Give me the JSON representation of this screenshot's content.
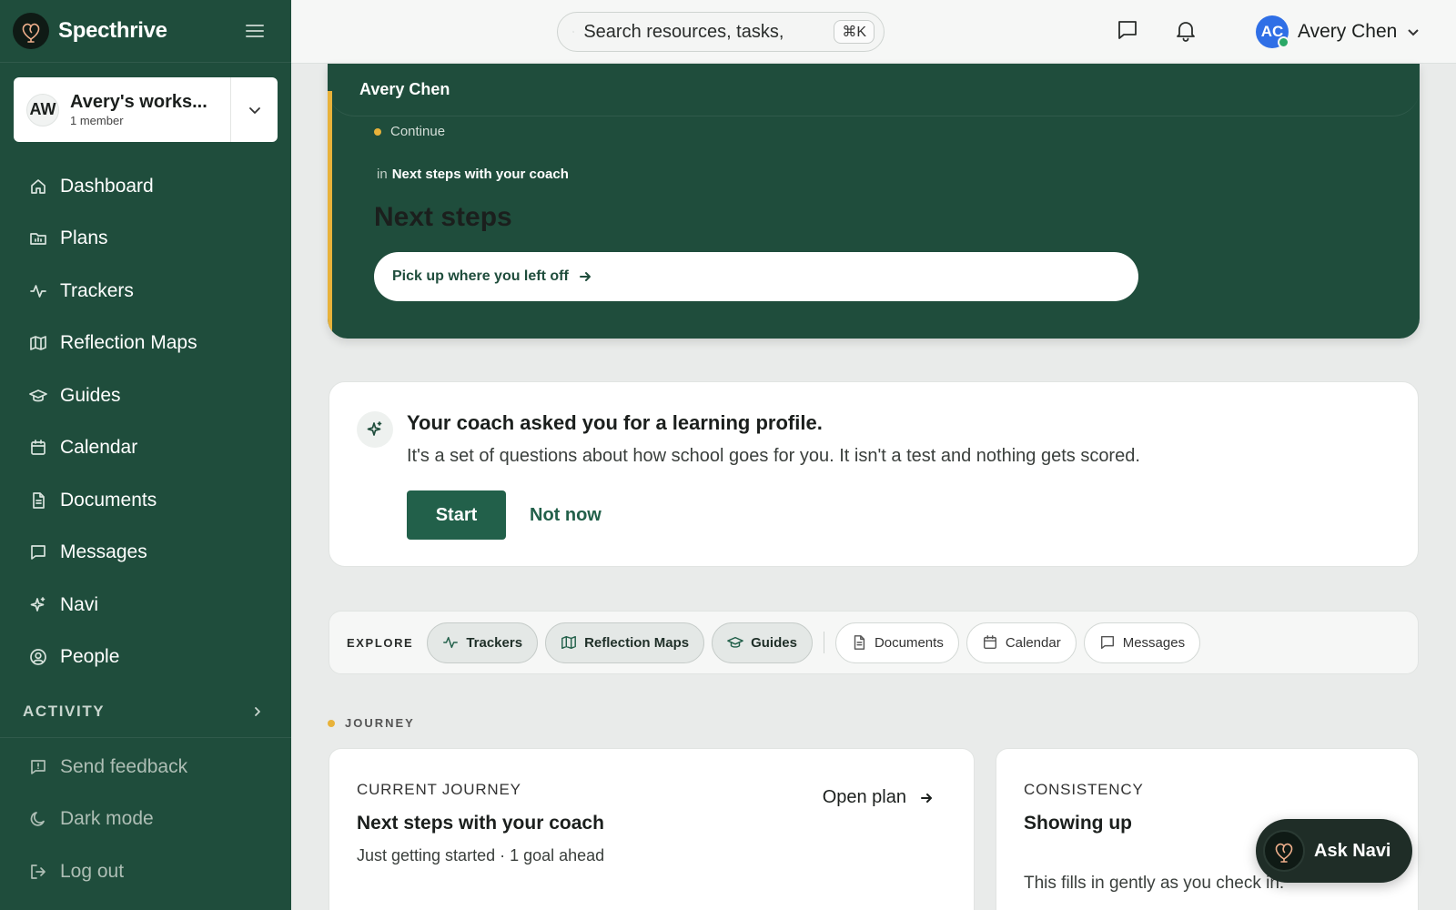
{
  "brand": {
    "name": "Specthrive"
  },
  "workspace": {
    "initials": "AW",
    "name": "Avery's works...",
    "members": "1 member"
  },
  "nav": {
    "items": [
      {
        "label": "Dashboard"
      },
      {
        "label": "Plans"
      },
      {
        "label": "Trackers"
      },
      {
        "label": "Reflection Maps"
      },
      {
        "label": "Guides"
      },
      {
        "label": "Calendar"
      },
      {
        "label": "Documents"
      },
      {
        "label": "Messages"
      },
      {
        "label": "Navi"
      },
      {
        "label": "People"
      }
    ],
    "section": "ACTIVITY",
    "footer": [
      {
        "label": "Send feedback"
      },
      {
        "label": "Dark mode"
      },
      {
        "label": "Log out"
      }
    ]
  },
  "topbar": {
    "search_placeholder": "Search resources, tasks,",
    "shortcut": "⌘K",
    "user_initials": "AC",
    "user_name": "Avery Chen"
  },
  "hero": {
    "owner": "Avery Chen",
    "status": "Continue",
    "context_prefix": "in",
    "context": "Next steps with your coach",
    "title": "Next steps",
    "cta": "Pick up where you left off"
  },
  "prompt": {
    "title": "Your coach asked you for a learning profile.",
    "body": "It's a set of questions about how school goes for you. It isn't a test and nothing gets scored.",
    "start": "Start",
    "later": "Not now"
  },
  "explore": {
    "label": "EXPLORE",
    "primary": [
      "Trackers",
      "Reflection Maps",
      "Guides"
    ],
    "secondary": [
      "Documents",
      "Calendar",
      "Messages"
    ]
  },
  "journey": {
    "section": "JOURNEY",
    "current": {
      "eyebrow": "CURRENT JOURNEY",
      "title": "Next steps with your coach",
      "sub": "Just getting started · 1 goal ahead",
      "link": "Open plan"
    },
    "consistency": {
      "eyebrow": "CONSISTENCY",
      "title": "Showing up",
      "body": "This fills in gently as you check in."
    }
  },
  "ask_navi": "Ask Navi",
  "colors": {
    "sidebar": "#1f4d3c",
    "accent": "#e8b23a",
    "primary_button": "#22604a",
    "avatar": "#2f6fe6"
  }
}
